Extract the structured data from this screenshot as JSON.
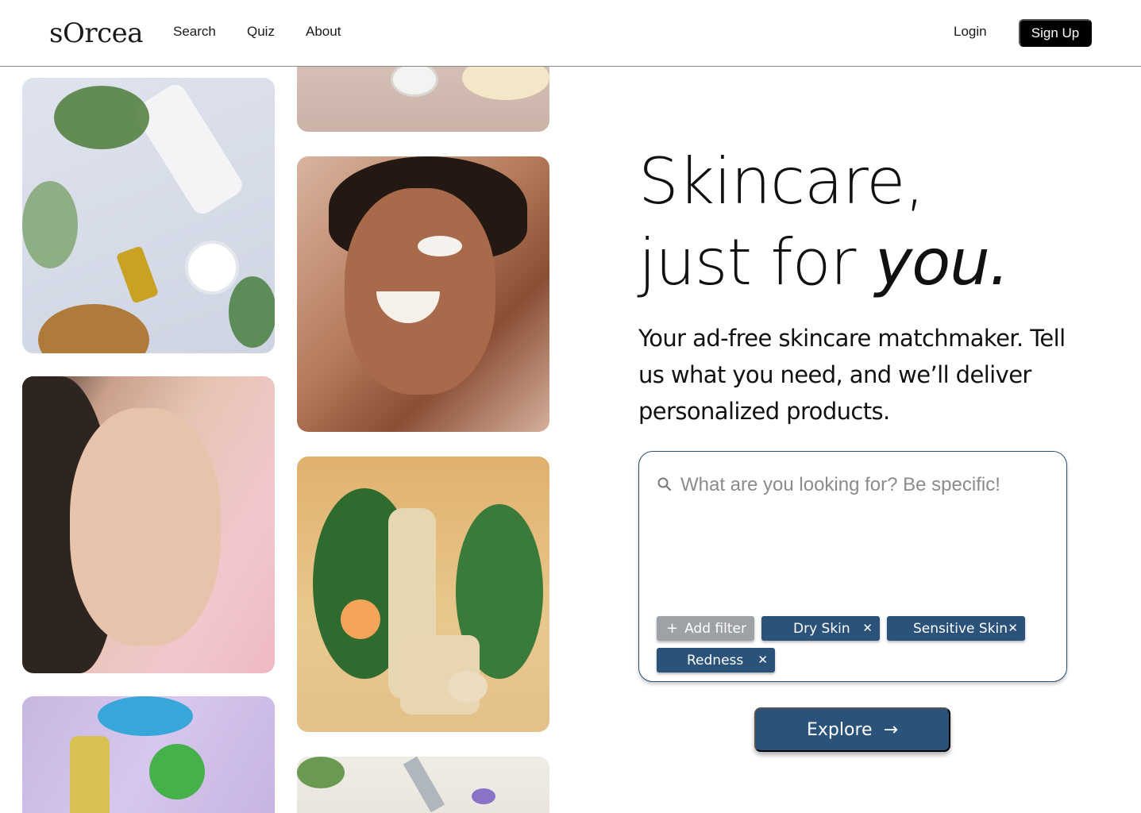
{
  "nav": {
    "logo": "sOrcea",
    "links": [
      "Search",
      "Quiz",
      "About"
    ],
    "login": "Login",
    "signup": "Sign Up"
  },
  "gallery": {
    "images": [
      "skincare-flatlay-flowers",
      "woman-eyes-closed-pink",
      "serum-bottles-purple",
      "product-jars-top",
      "smiling-woman-face-cream",
      "cream-bottles-tropical-leaves",
      "dropper-bottles-flatlay"
    ]
  },
  "hero": {
    "title_line1": "Skincare,",
    "title_line2_prefix": "just for ",
    "title_line2_emphasis": "you.",
    "subtitle": "Your ad-free skincare matchmaker. Tell us what you need, and we’ll deliver personalized products."
  },
  "search": {
    "placeholder": "What are you looking for? Be specific!",
    "value": "",
    "add_filter": "Add filter",
    "filters": [
      "Dry Skin",
      "Sensitive Skin",
      "Redness"
    ]
  },
  "cta": {
    "explore": "Explore",
    "explore_icon": "arrow-right-icon"
  },
  "colors": {
    "primary": "#2b5279",
    "add_filter_bg": "#9ea2a6",
    "signup_bg": "#000000"
  }
}
